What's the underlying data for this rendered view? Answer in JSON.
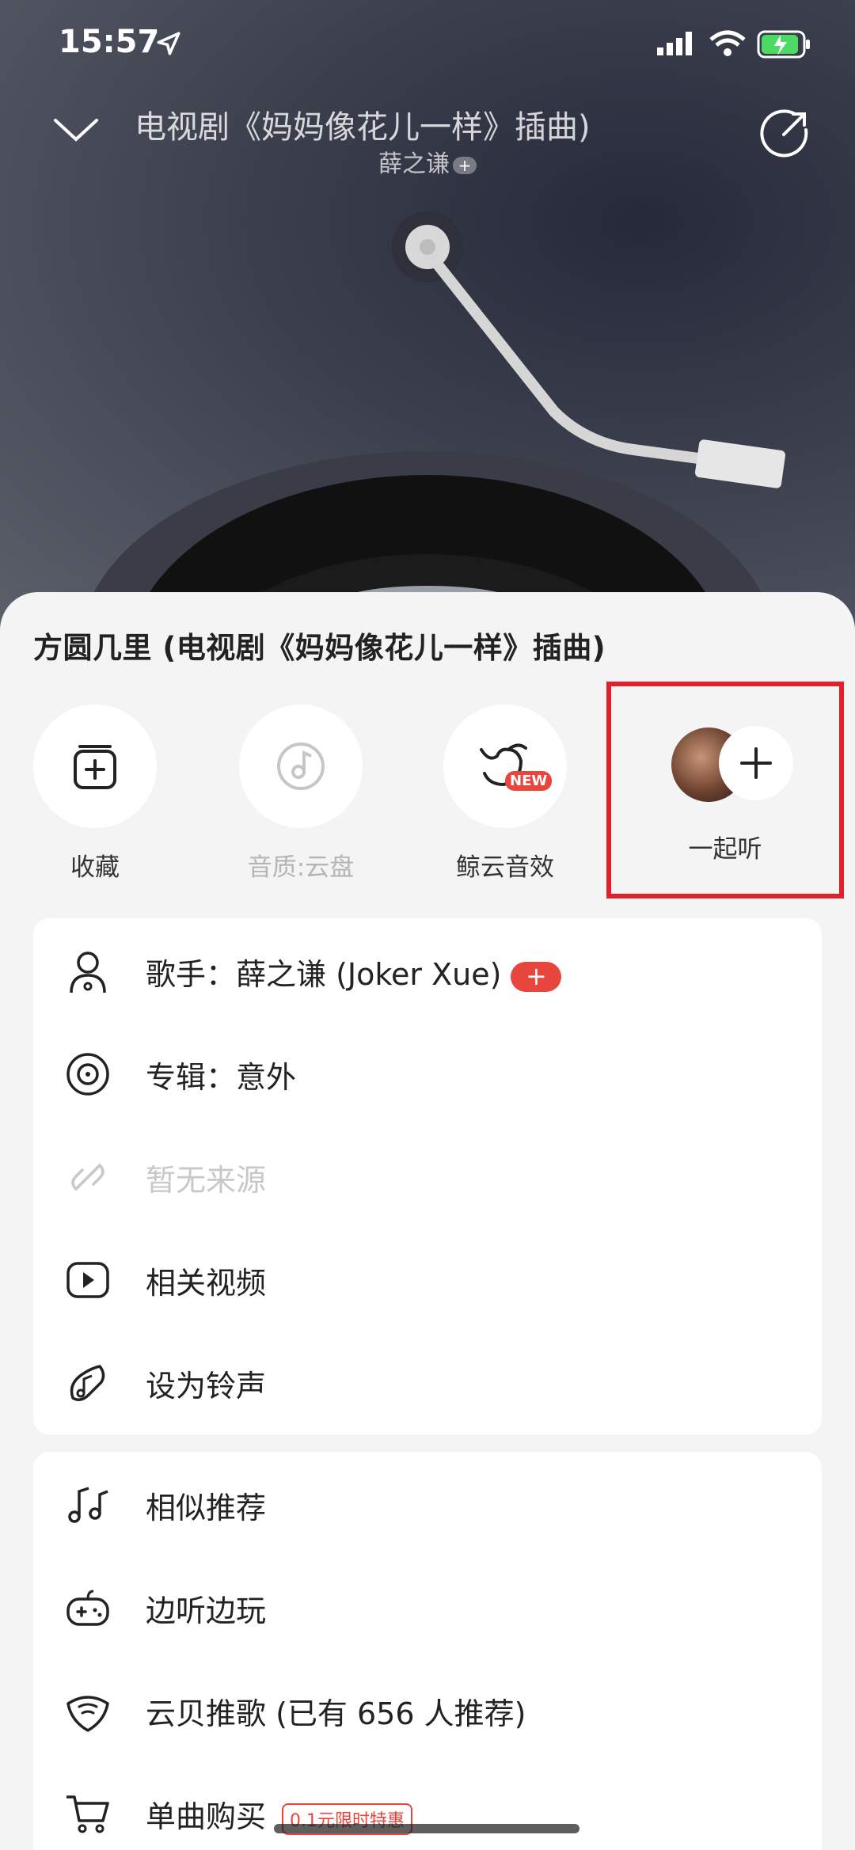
{
  "status_bar": {
    "time": "15:57"
  },
  "player": {
    "song_title_scrolling": "电视剧《妈妈像花儿一样》插曲)",
    "artist": "薛之谦",
    "artist_follow": "+"
  },
  "sheet": {
    "title": "方圆几里 (电视剧《妈妈像花儿一样》插曲)",
    "actions": [
      {
        "label": "收藏",
        "icon": "collect-icon"
      },
      {
        "label": "音质:云盘",
        "icon": "quality-icon"
      },
      {
        "label": "鲸云音效",
        "icon": "whale-effect-icon",
        "badge": "NEW"
      },
      {
        "label": "一起听",
        "icon": "listen-together-icon"
      }
    ],
    "card1": [
      {
        "label": "歌手：薛之谦 (Joker Xue)",
        "icon": "singer-icon",
        "badge": "+"
      },
      {
        "label": "专辑：意外",
        "icon": "album-icon"
      },
      {
        "label": "暂无来源",
        "icon": "link-icon"
      },
      {
        "label": "相关视频",
        "icon": "video-icon"
      },
      {
        "label": "设为铃声",
        "icon": "ringtone-icon"
      }
    ],
    "card2": [
      {
        "label": "相似推荐",
        "icon": "similar-icon"
      },
      {
        "label": "边听边玩",
        "icon": "gamepad-icon"
      },
      {
        "label": "云贝推歌 (已有 656 人推荐)",
        "icon": "cloud-shell-icon"
      },
      {
        "label": "单曲购买",
        "icon": "cart-icon",
        "promo": "0.1元限时特惠"
      }
    ]
  }
}
